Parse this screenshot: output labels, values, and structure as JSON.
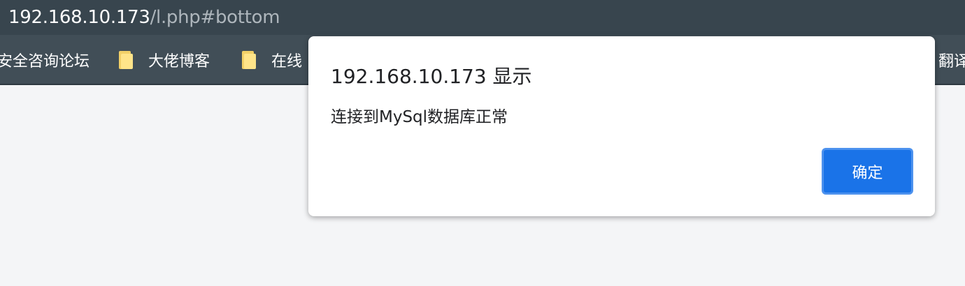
{
  "address_bar": {
    "host": "192.168.10.173",
    "path": "/l.php#bottom"
  },
  "bookmarks": [
    {
      "label": "安全咨询论坛",
      "icon": "folder-icon"
    },
    {
      "label": "大佬博客",
      "icon": "folder-icon"
    },
    {
      "label": "在线",
      "icon": "folder-icon"
    },
    {
      "label": "翻译",
      "icon": "folder-icon"
    }
  ],
  "dialog": {
    "title": "192.168.10.173 显示",
    "message": "连接到MySql数据库正常",
    "ok_label": "确定"
  },
  "colors": {
    "toolbar": "#38454e",
    "bookmarks_bar": "#414e57",
    "accent": "#1a73e8",
    "folder": "#ffe489"
  }
}
